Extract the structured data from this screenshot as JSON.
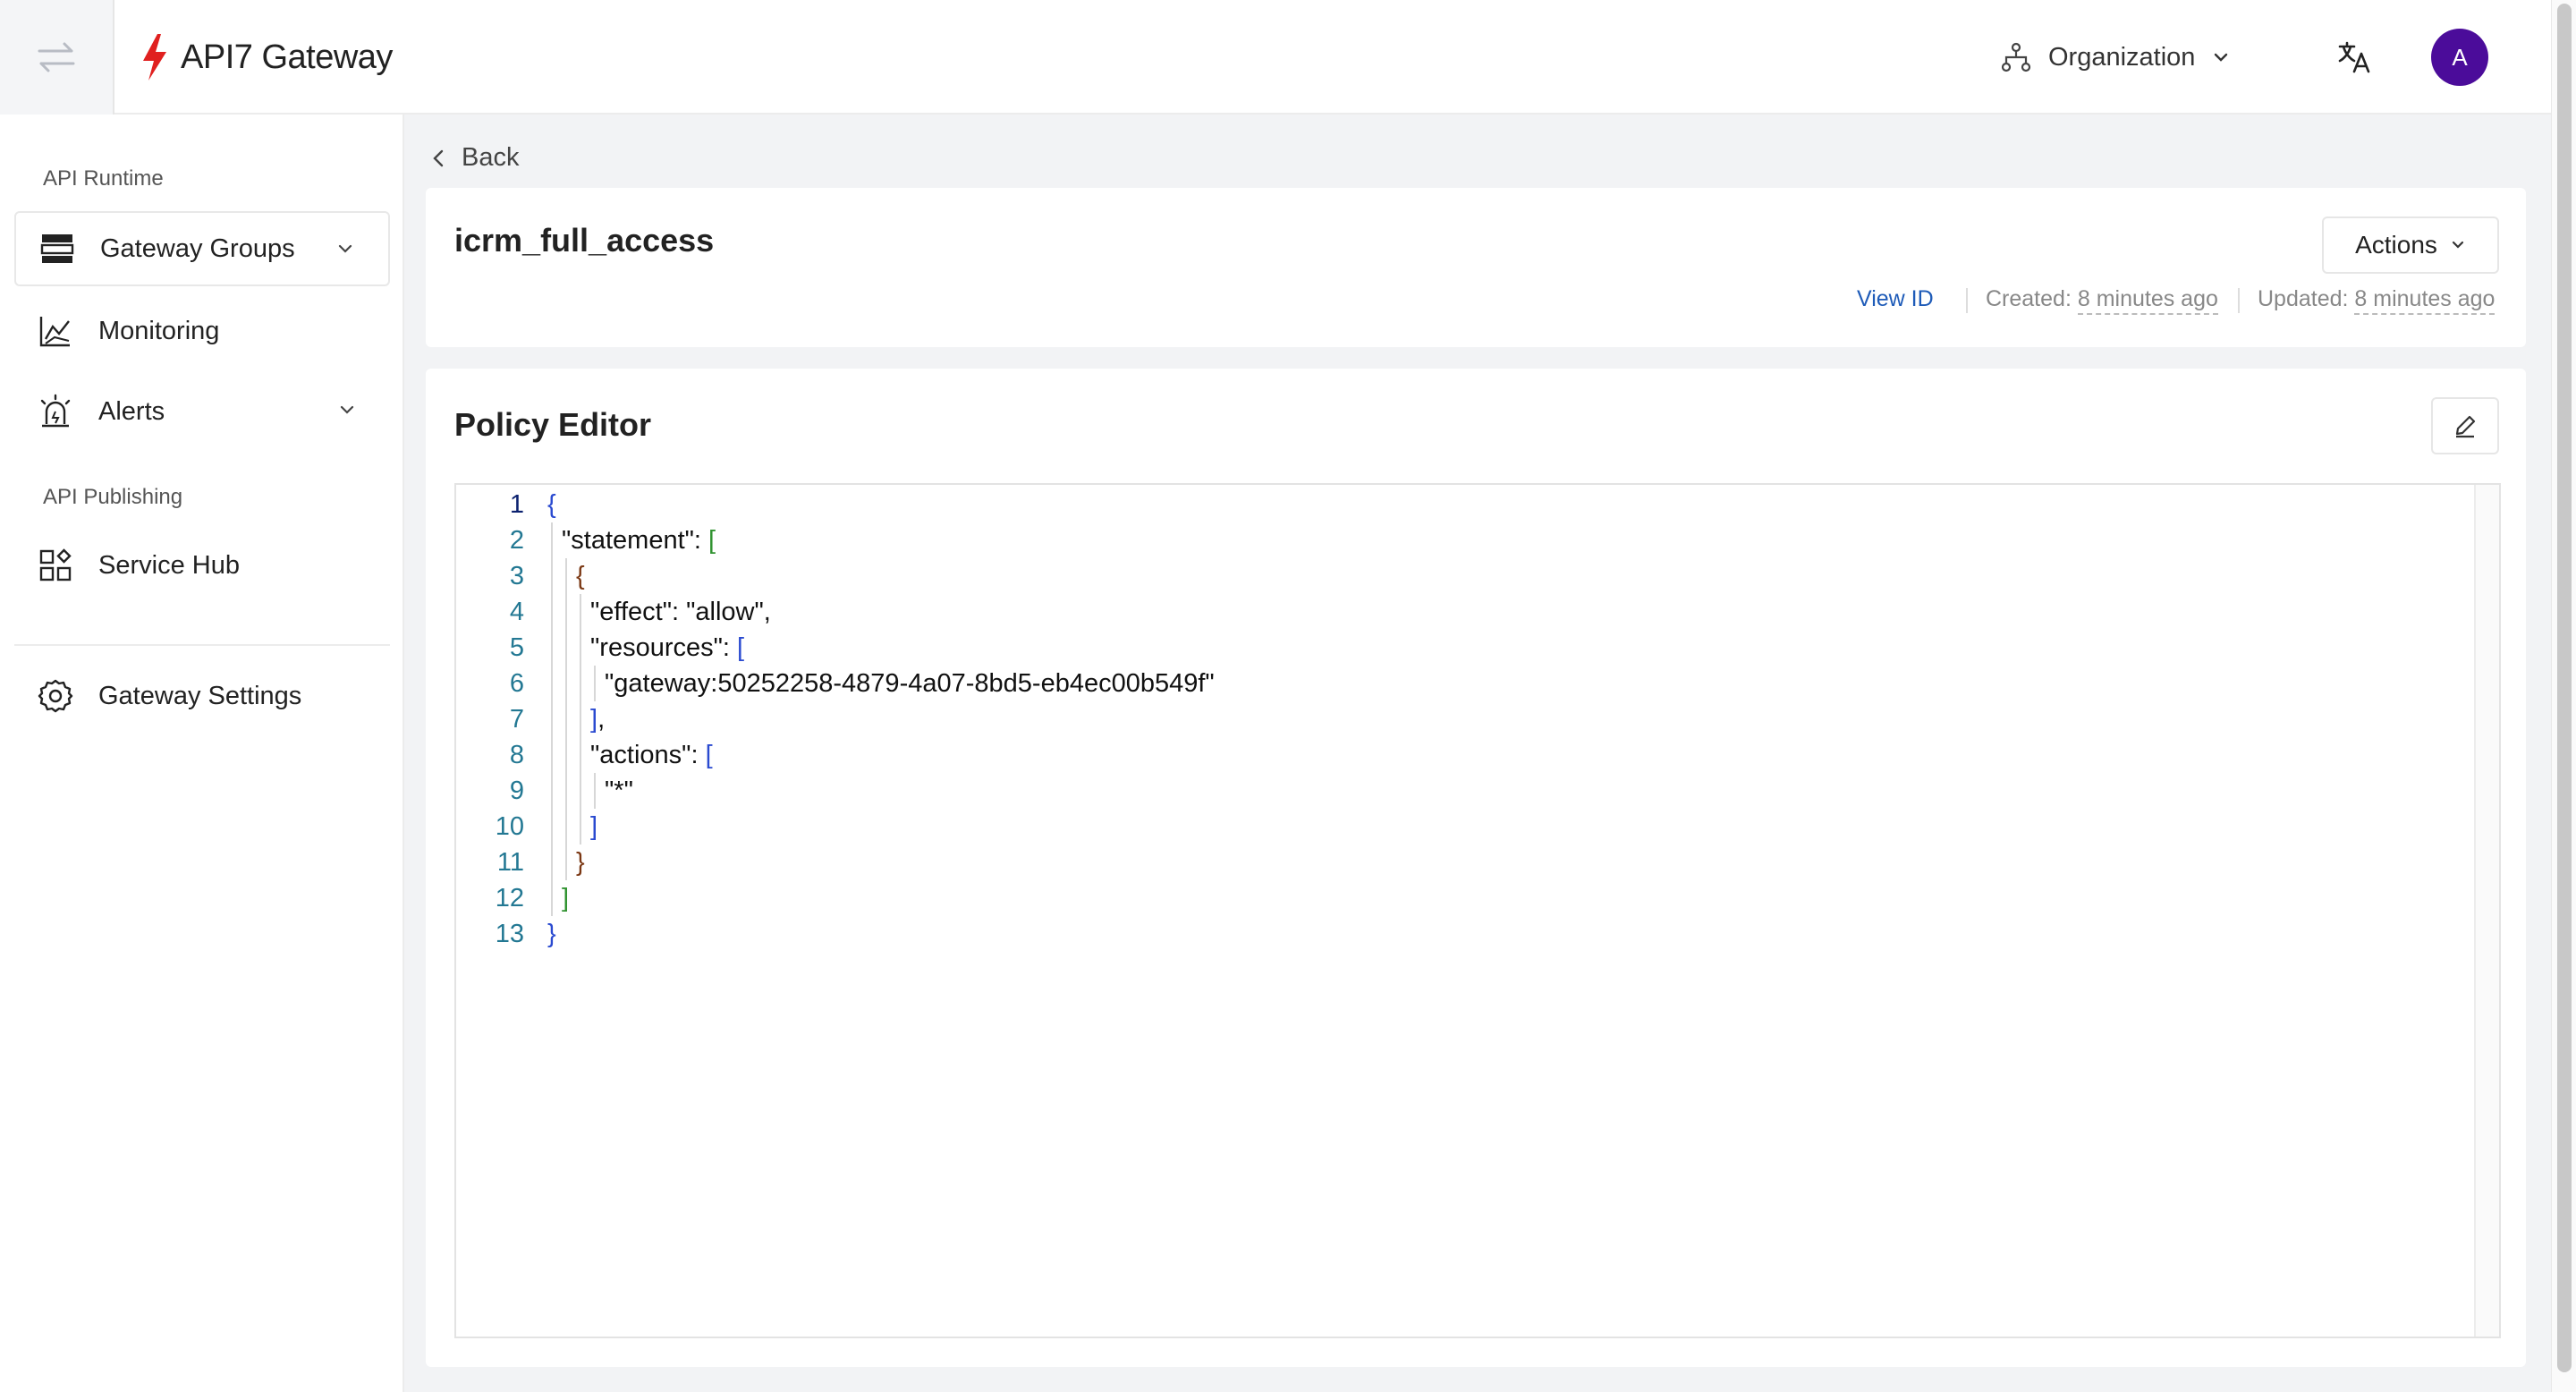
{
  "header": {
    "logo_text": "API7 Gateway",
    "org_label": "Organization",
    "avatar_letter": "A"
  },
  "sidebar": {
    "sections": [
      {
        "label": "API Runtime"
      },
      {
        "label": "API Publishing"
      }
    ],
    "items": [
      {
        "label": "Gateway Groups",
        "icon": "server-icon"
      },
      {
        "label": "Monitoring",
        "icon": "line-chart-icon"
      },
      {
        "label": "Alerts",
        "icon": "alarm-icon"
      },
      {
        "label": "Service Hub",
        "icon": "apps-icon"
      },
      {
        "label": "Gateway Settings",
        "icon": "gear-icon"
      }
    ]
  },
  "main": {
    "back_label": "Back",
    "policy_name": "icrm_full_access",
    "actions_label": "Actions",
    "view_id_label": "View ID",
    "created_label": "Created:",
    "created_value": "8 minutes ago",
    "updated_label": "Updated:",
    "updated_value": "8 minutes ago",
    "editor_title": "Policy Editor"
  },
  "code": {
    "lines": [
      {
        "n": "1",
        "pre": "",
        "key": "",
        "mid": "",
        "br": "{",
        "brc": "br-blue",
        "post": "",
        "indent": 0
      },
      {
        "n": "2",
        "pre": "",
        "key": "\"statement\": ",
        "mid": "",
        "br": "[",
        "brc": "br-green",
        "post": "",
        "indent": 1
      },
      {
        "n": "3",
        "pre": "",
        "key": "",
        "mid": "",
        "br": "{",
        "brc": "br-brown",
        "post": "",
        "indent": 2
      },
      {
        "n": "4",
        "pre": "",
        "key": "\"effect\": \"allow\",",
        "mid": "",
        "br": "",
        "brc": "",
        "post": "",
        "indent": 3
      },
      {
        "n": "5",
        "pre": "",
        "key": "\"resources\": ",
        "mid": "",
        "br": "[",
        "brc": "br-blue",
        "post": "",
        "indent": 3
      },
      {
        "n": "6",
        "pre": "",
        "key": "\"gateway:50252258-4879-4a07-8bd5-eb4ec00b549f\"",
        "mid": "",
        "br": "",
        "brc": "",
        "post": "",
        "indent": 4
      },
      {
        "n": "7",
        "pre": "",
        "key": "",
        "mid": "",
        "br": "]",
        "brc": "br-blue",
        "post": ",",
        "indent": 3
      },
      {
        "n": "8",
        "pre": "",
        "key": "\"actions\": ",
        "mid": "",
        "br": "[",
        "brc": "br-blue",
        "post": "",
        "indent": 3
      },
      {
        "n": "9",
        "pre": "",
        "key": "\"*\"",
        "mid": "",
        "br": "",
        "brc": "",
        "post": "",
        "indent": 4
      },
      {
        "n": "10",
        "pre": "",
        "key": "",
        "mid": "",
        "br": "]",
        "brc": "br-blue",
        "post": "",
        "indent": 3
      },
      {
        "n": "11",
        "pre": "",
        "key": "",
        "mid": "",
        "br": "}",
        "brc": "br-brown",
        "post": "",
        "indent": 2
      },
      {
        "n": "12",
        "pre": "",
        "key": "",
        "mid": "",
        "br": "]",
        "brc": "br-green",
        "post": "",
        "indent": 1
      },
      {
        "n": "13",
        "pre": "",
        "key": "",
        "mid": "",
        "br": "}",
        "brc": "br-blue",
        "post": "",
        "indent": 0
      }
    ]
  },
  "colors": {
    "accent": "#1e5bb8",
    "avatar_bg": "#4b0c9a",
    "logo_red": "#e0201f"
  }
}
